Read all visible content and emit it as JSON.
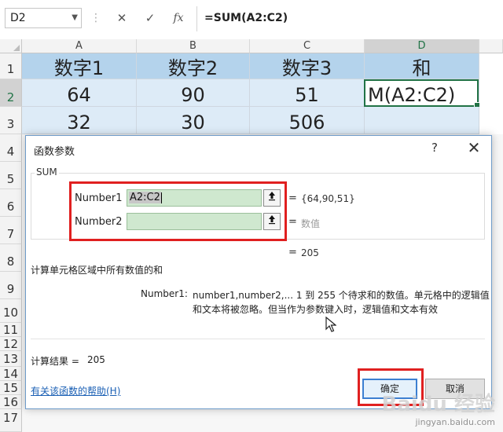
{
  "formula_bar": {
    "name_box": "D2",
    "cancel_icon": "✕",
    "enter_icon": "✓",
    "fx_label": "fx",
    "formula": "=SUM(A2:C2)"
  },
  "columns": [
    "A",
    "B",
    "C",
    "D"
  ],
  "rows": [
    "1",
    "2",
    "3",
    "4",
    "5",
    "6",
    "7",
    "8",
    "9",
    "10",
    "11",
    "12",
    "13",
    "14",
    "15",
    "16",
    "17"
  ],
  "cells": {
    "header": [
      "数字1",
      "数字2",
      "数字3",
      "和"
    ],
    "row2": [
      "64",
      "90",
      "51",
      "M(A2:C2)"
    ],
    "row3": [
      "32",
      "30",
      "506",
      ""
    ]
  },
  "dialog": {
    "title": "函数参数",
    "help_icon": "?",
    "close_icon": "✕",
    "function_name": "SUM",
    "args": [
      {
        "label": "Number1",
        "value": "A2:C2",
        "result": "{64,90,51}"
      },
      {
        "label": "Number2",
        "value": "",
        "result": "数值"
      }
    ],
    "equals": "=",
    "formula_result": "205",
    "description": "计算单元格区域中所有数值的和",
    "arg_desc_label": "Number1:",
    "arg_desc_line1": "number1,number2,... 1 到 255 个待求和的数值。单元格中的逻辑值",
    "arg_desc_line2": "和文本将被忽略。但当作为参数键入时，逻辑值和文本有效",
    "calc_result_label": "计算结果 =",
    "calc_result_value": "205",
    "help_link": "有关该函数的帮助(H)",
    "ok_label": "确定",
    "cancel_label": "取消"
  },
  "watermark": {
    "logo": "Baidu 经验",
    "url": "jingyan.baidu.com"
  },
  "colors": {
    "header_fill": "#b4d3ec",
    "data_fill": "#ddebf7",
    "active_border": "#217346",
    "highlight_red": "#e02020",
    "input_fill": "#cfe8cf"
  }
}
